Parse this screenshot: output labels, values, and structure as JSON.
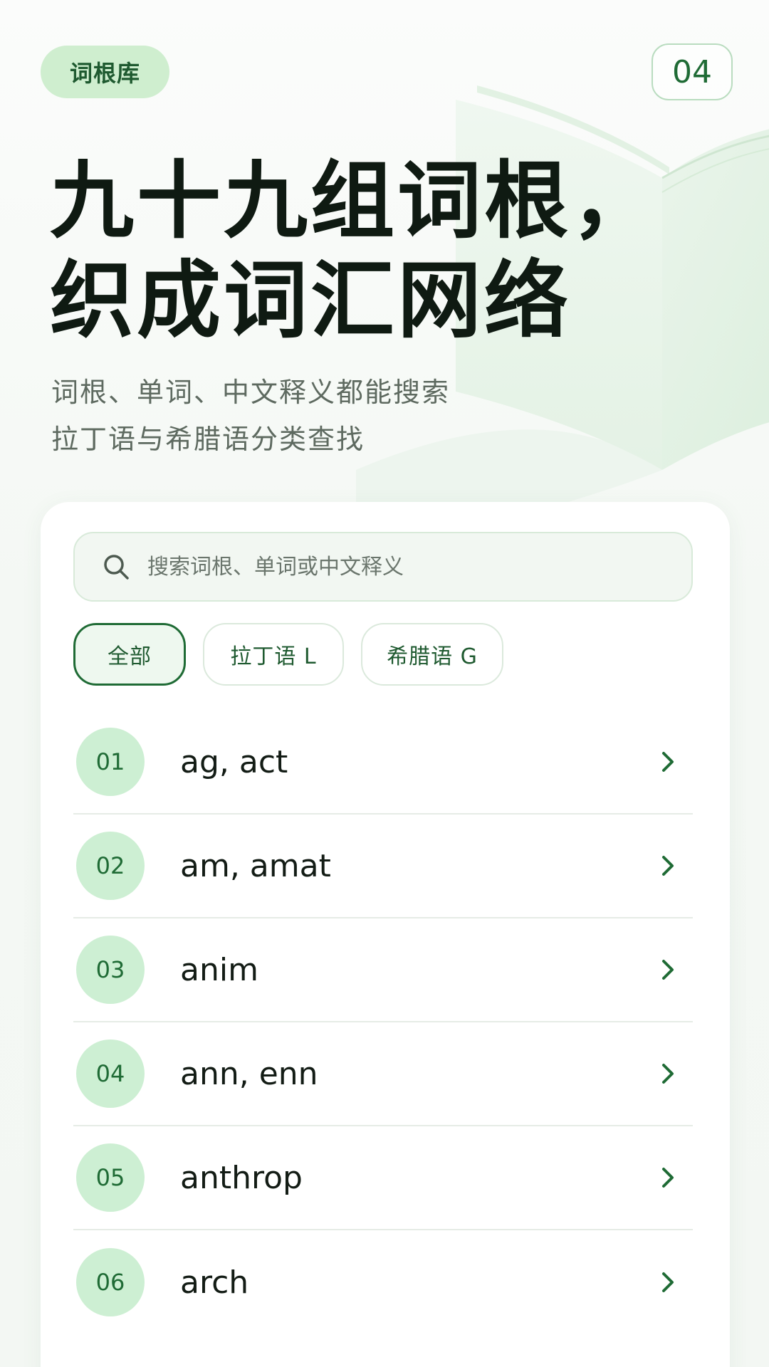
{
  "header": {
    "badge": "词根库",
    "page_number": "04"
  },
  "hero": {
    "title_line1": "九十九组词根，",
    "title_line2": "织成词汇网络",
    "subtitle_line1": "词根、单词、中文释义都能搜索",
    "subtitle_line2": "拉丁语与希腊语分类查找"
  },
  "search": {
    "placeholder": "搜索词根、单词或中文释义",
    "value": ""
  },
  "filters": [
    {
      "label": "全部",
      "active": true
    },
    {
      "label": "拉丁语 L",
      "active": false
    },
    {
      "label": "希腊语 G",
      "active": false
    }
  ],
  "roots": [
    {
      "num": "01",
      "name": "ag, act"
    },
    {
      "num": "02",
      "name": "am, amat"
    },
    {
      "num": "03",
      "name": "anim"
    },
    {
      "num": "04",
      "name": "ann, enn"
    },
    {
      "num": "05",
      "name": "anthrop"
    },
    {
      "num": "06",
      "name": "arch"
    }
  ],
  "icons": {
    "search": "search-icon",
    "row_arrow": "chevron-right-icon",
    "background": "open-book-icon"
  },
  "colors": {
    "accent": "#1f6b35",
    "accent_light": "#cdefd3",
    "title": "#0f1a12",
    "subtitle": "#5e6a60"
  }
}
